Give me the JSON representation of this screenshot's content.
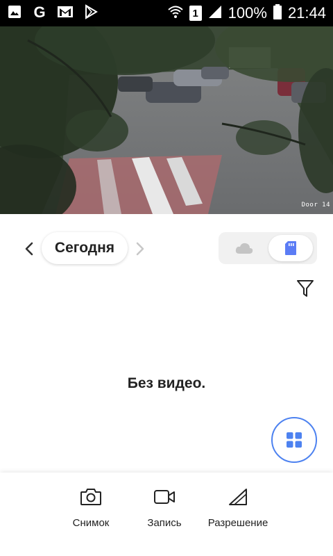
{
  "status_bar": {
    "battery": "100%",
    "time": "21:44",
    "sim_slot": "1",
    "icons": [
      "gallery-icon",
      "google-icon",
      "gmail-icon",
      "play-store-icon",
      "wifi-icon",
      "sim-icon",
      "signal-icon",
      "battery-icon"
    ]
  },
  "camera": {
    "overlay_label": "Door 14"
  },
  "date_bar": {
    "date_label": "Сегодня",
    "storage_options": [
      "cloud-icon",
      "sd-card-icon"
    ],
    "selected_storage": "sd-card"
  },
  "content": {
    "empty_message": "Без видео."
  },
  "actions": [
    {
      "label": "Снимок",
      "icon": "camera-icon"
    },
    {
      "label": "Запись",
      "icon": "video-icon"
    },
    {
      "label": "Разрешение",
      "icon": "resolution-icon"
    }
  ],
  "colors": {
    "accent": "#4d82f0",
    "sd_icon": "#5b7cf5",
    "text": "#222222"
  }
}
